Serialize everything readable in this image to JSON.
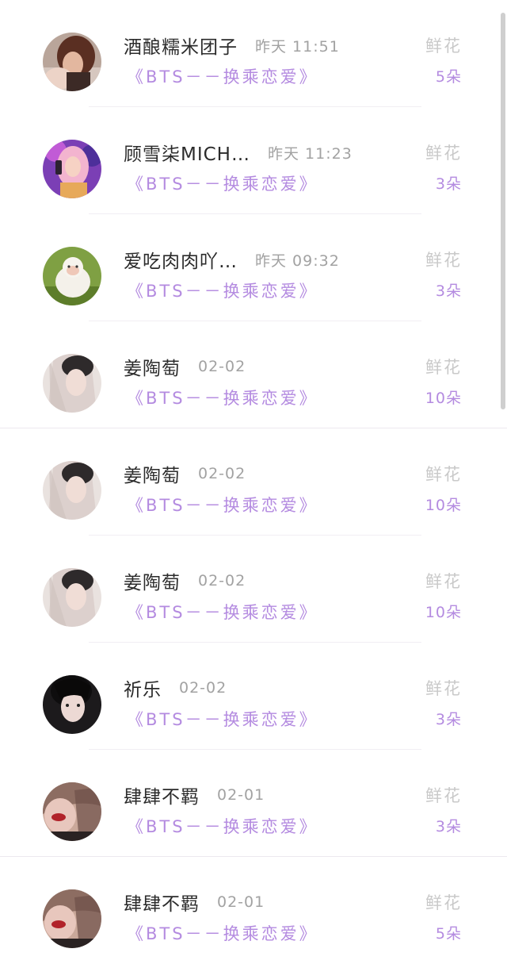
{
  "colors": {
    "book_title": "#b48be0",
    "gift_count": "#b48be0",
    "gift_label": "#c9c9c9",
    "name": "#2b2b2b",
    "time": "#a2a2a2"
  },
  "entries": [
    {
      "name": "酒酿糯米团子",
      "time": "昨天 11:51",
      "book": "《BTS－－换乘恋爱》",
      "gift_label": "鲜花",
      "gift_count": "5朵",
      "avatar": "avatar-woman-icon"
    },
    {
      "name": "顾雪柒MICH…",
      "time": "昨天 11:23",
      "book": "《BTS－－换乘恋爱》",
      "gift_label": "鲜花",
      "gift_count": "3朵",
      "avatar": "avatar-pink-hair-icon"
    },
    {
      "name": "爱吃肉肉吖…",
      "time": "昨天 09:32",
      "book": "《BTS－－换乘恋爱》",
      "gift_label": "鲜花",
      "gift_count": "3朵",
      "avatar": "avatar-sheep-icon"
    },
    {
      "name": "姜陶萄",
      "time": "02-02",
      "book": "《BTS－－换乘恋爱》",
      "gift_label": "鲜花",
      "gift_count": "10朵",
      "avatar": "avatar-veil-icon"
    },
    {
      "name": "姜陶萄",
      "time": "02-02",
      "book": "《BTS－－换乘恋爱》",
      "gift_label": "鲜花",
      "gift_count": "10朵",
      "avatar": "avatar-veil-icon"
    },
    {
      "name": "姜陶萄",
      "time": "02-02",
      "book": "《BTS－－换乘恋爱》",
      "gift_label": "鲜花",
      "gift_count": "10朵",
      "avatar": "avatar-veil-icon"
    },
    {
      "name": "祈乐",
      "time": "02-02",
      "book": "《BTS－－换乘恋爱》",
      "gift_label": "鲜花",
      "gift_count": "3朵",
      "avatar": "avatar-dark-hair-icon"
    },
    {
      "name": "肆肆不羁",
      "time": "02-01",
      "book": "《BTS－－换乘恋爱》",
      "gift_label": "鲜花",
      "gift_count": "3朵",
      "avatar": "avatar-red-lips-icon"
    },
    {
      "name": "肆肆不羁",
      "time": "02-01",
      "book": "《BTS－－换乘恋爱》",
      "gift_label": "鲜花",
      "gift_count": "5朵",
      "avatar": "avatar-red-lips-icon"
    }
  ]
}
